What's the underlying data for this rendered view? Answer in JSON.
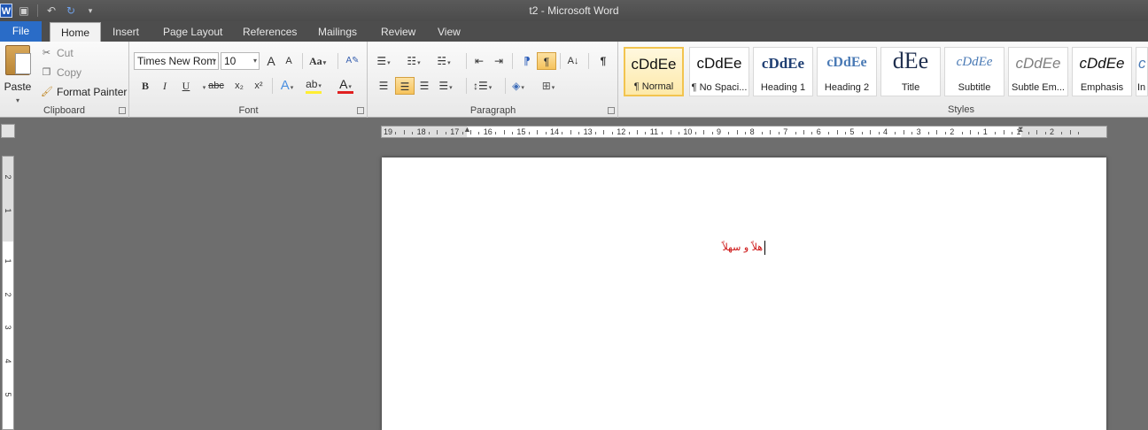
{
  "window": {
    "title": "t2 - Microsoft Word"
  },
  "qat": {
    "word_logo": "W",
    "save_icon": "save-icon",
    "undo_icon": "undo-icon",
    "redo_icon": "redo-icon",
    "customize_icon": "chevron-down-icon"
  },
  "tabs": [
    {
      "label": "File"
    },
    {
      "label": "Home"
    },
    {
      "label": "Insert"
    },
    {
      "label": "Page Layout"
    },
    {
      "label": "References"
    },
    {
      "label": "Mailings"
    },
    {
      "label": "Review"
    },
    {
      "label": "View"
    }
  ],
  "clipboard": {
    "paste": "Paste",
    "cut": "Cut",
    "copy": "Copy",
    "format_painter": "Format Painter",
    "label": "Clipboard"
  },
  "font": {
    "name": "Times New Rom",
    "size": "10",
    "grow": "A",
    "shrink": "A",
    "change_case": "Aa",
    "bold": "B",
    "italic": "I",
    "underline": "U",
    "strike": "abc",
    "subscript": "x₂",
    "superscript": "x²",
    "text_effects": "A",
    "highlight": "ab",
    "font_color": "A",
    "label": "Font"
  },
  "paragraph": {
    "label": "Paragraph"
  },
  "styles": {
    "label": "Styles",
    "items": [
      {
        "sample": "cDdEe",
        "name": "¶ Normal"
      },
      {
        "sample": "cDdEe",
        "name": "¶ No Spaci..."
      },
      {
        "sample": "cDdEe",
        "name": "Heading 1"
      },
      {
        "sample": "cDdEe",
        "name": "Heading 2"
      },
      {
        "sample": "dEe",
        "name": "Title"
      },
      {
        "sample": "cDdEe",
        "name": "Subtitle"
      },
      {
        "sample": "cDdEe",
        "name": "Subtle Em..."
      },
      {
        "sample": "cDdEe",
        "name": "Emphasis"
      },
      {
        "sample": "c",
        "name": "In"
      }
    ]
  },
  "ruler": {
    "labels": [
      "19",
      "18",
      "17",
      "16",
      "15",
      "14",
      "13",
      "12",
      "11",
      "10",
      "9",
      "8",
      "7",
      "6",
      "5",
      "4",
      "3",
      "2",
      "1",
      "1",
      "2"
    ]
  },
  "vruler": {
    "labels": [
      "2",
      "1",
      "1",
      "2",
      "3",
      "4",
      "5"
    ]
  },
  "document": {
    "text": "هلاً و سهلاً"
  },
  "colors": {
    "accent": "#2a6cc7",
    "selected_style": "#fde9a9",
    "text_red": "#cc1111"
  }
}
